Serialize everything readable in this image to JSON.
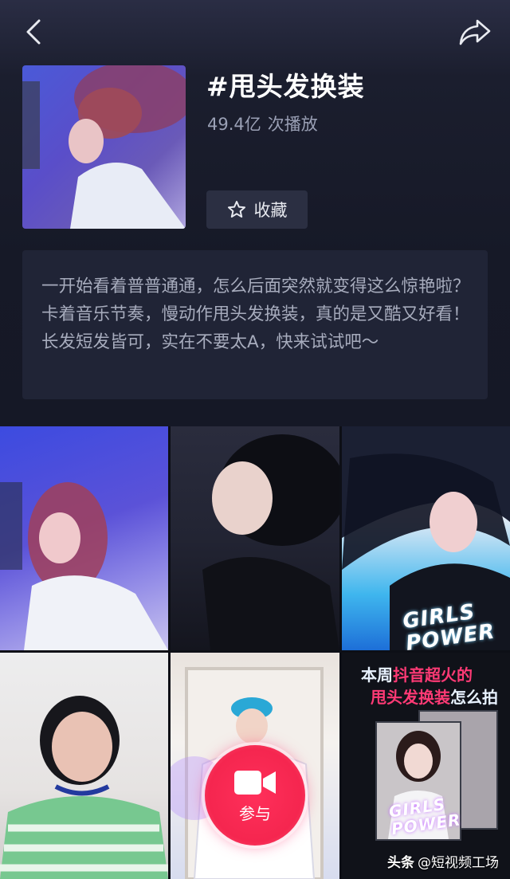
{
  "header": {
    "title": "#甩头发换装",
    "play_count": "49.4亿",
    "play_suffix": "次播放",
    "favorite_label": "收藏"
  },
  "description": "一开始看着普普通通，怎么后面突然就变得这么惊艳啦？卡着音乐节奏，慢动作甩头发换装，真的是又酷又好看！长发短发皆可，实在不要太A，快来试试吧～",
  "grid": {
    "tile3_overlay": "GIRLS POWER",
    "promo_line1_a": "本周",
    "promo_line1_b": "抖音超火的",
    "promo_line2_a": "甩头发换装",
    "promo_line2_b": "怎么拍",
    "promo_overlay": "GIRLS POWER"
  },
  "join_label": "参与",
  "watermark": {
    "brand": "头条",
    "account": "@短视频工场"
  },
  "colors": {
    "background": "#151826",
    "panel": "#202436",
    "button": "#2b2f42",
    "accent": "#f5264f",
    "muted_text": "#9aa0b5"
  },
  "icons": [
    "back-icon",
    "share-icon",
    "star-icon",
    "video-camera-icon"
  ]
}
